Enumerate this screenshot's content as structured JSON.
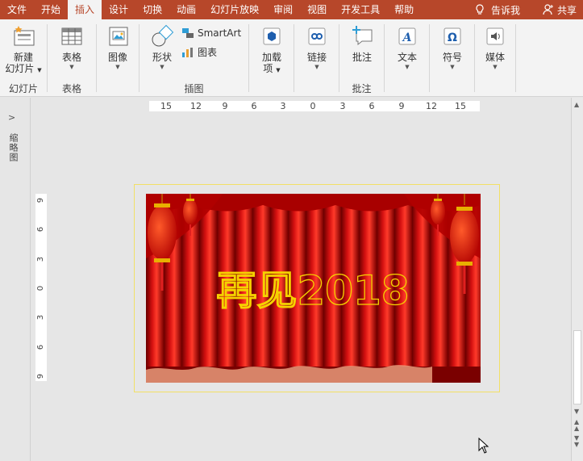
{
  "tabs": [
    "文件",
    "开始",
    "插入",
    "设计",
    "切换",
    "动画",
    "幻灯片放映",
    "审阅",
    "视图",
    "开发工具",
    "帮助"
  ],
  "active_tab": "插入",
  "tell_me": "告诉我",
  "share": "共享",
  "ribbon": {
    "slides": {
      "btn_line1": "新建",
      "btn_line2": "幻灯片",
      "label": "幻灯片"
    },
    "tables": {
      "btn": "表格",
      "label": "表格"
    },
    "images": {
      "btn": "图像"
    },
    "illustrations": {
      "shapes": "形状",
      "smartart": "SmartArt",
      "chart": "图表",
      "label": "插图"
    },
    "addins": {
      "btn_line1": "加载",
      "btn_line2": "项"
    },
    "links": {
      "btn": "链接"
    },
    "comments": {
      "btn": "批注",
      "label": "批注"
    },
    "text": {
      "btn": "文本"
    },
    "symbols": {
      "btn": "符号"
    },
    "media": {
      "btn": "媒体"
    }
  },
  "left_pane": {
    "label": "缩略图"
  },
  "hruler": [
    "15",
    "12",
    "9",
    "6",
    "3",
    "0",
    "3",
    "6",
    "9",
    "12",
    "15"
  ],
  "vruler": [
    "9",
    "6",
    "3",
    "0",
    "3",
    "6",
    "9"
  ],
  "slide": {
    "title_text": "再见2018"
  },
  "colors": {
    "accent": "#b7472a",
    "ribbon_bg": "#f3f3f3",
    "title_stroke": "#f5d200",
    "curtain": "#c00000"
  }
}
